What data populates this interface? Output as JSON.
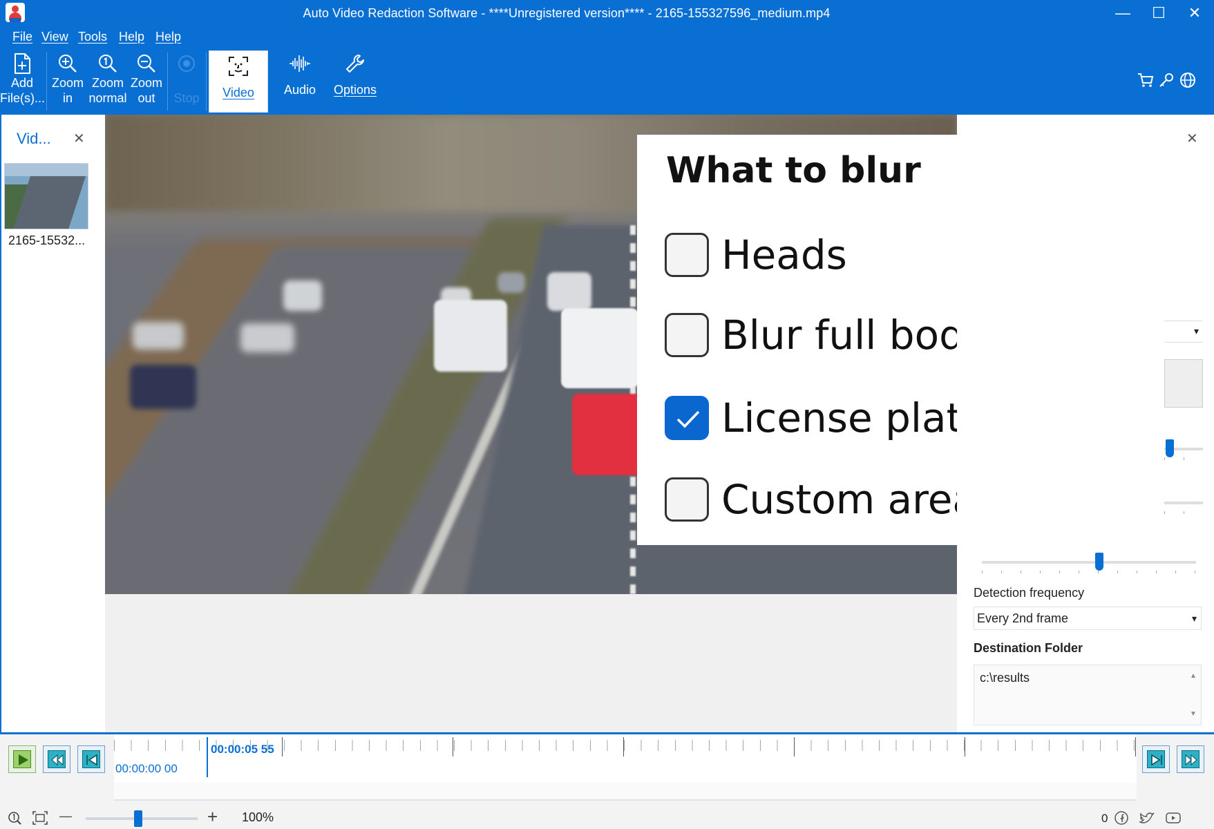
{
  "window": {
    "title": "Auto Video Redaction Software - ****Unregistered version**** - 2165-155327596_medium.mp4",
    "min_glyph": "—",
    "max_glyph": "☐",
    "close_glyph": "✕"
  },
  "menu": {
    "items": [
      "File",
      "View",
      "Tools",
      "Help",
      "Help"
    ]
  },
  "ribbon": {
    "add_files": [
      "Add",
      "File(s)..."
    ],
    "zoom_in": [
      "Zoom",
      "in"
    ],
    "zoom_normal": [
      "Zoom",
      "normal"
    ],
    "zoom_out": [
      "Zoom",
      "out"
    ],
    "stop": "Stop",
    "video": "Video",
    "audio": "Audio",
    "options": "Options",
    "active_tab": "Video"
  },
  "left_panel": {
    "title": "Vid...",
    "close_glyph": "✕",
    "file_label": "2165-15532..."
  },
  "blur_panel": {
    "title": "What to blur",
    "options": [
      {
        "label": "Heads",
        "checked": false
      },
      {
        "label": "Blur full body",
        "checked": false
      },
      {
        "label": "License plates",
        "checked": true
      },
      {
        "label": "Custom area",
        "checked": false
      }
    ]
  },
  "right_panel": {
    "close_glyph": "✕",
    "dropdown_arrow": "▾",
    "detection_frequency_label": "Detection frequency",
    "detection_frequency_value": "Every 2nd frame",
    "destination_label": "Destination Folder",
    "destination_value": "c:\\results",
    "scroll_up": "▲",
    "scroll_down": "▼",
    "slider1_value": 0.05,
    "slider2_value": 0.55
  },
  "timeline": {
    "current_time": "00:00:05 55",
    "start_time": "00:00:00 00",
    "zoom_level": "100%",
    "zoom_minus": "—",
    "zoom_plus": "+",
    "status_count": "0"
  },
  "colors": {
    "accent": "#0a6fd3",
    "checkbox_checked": "#0a67cf",
    "play_button": "#2db1c7"
  }
}
